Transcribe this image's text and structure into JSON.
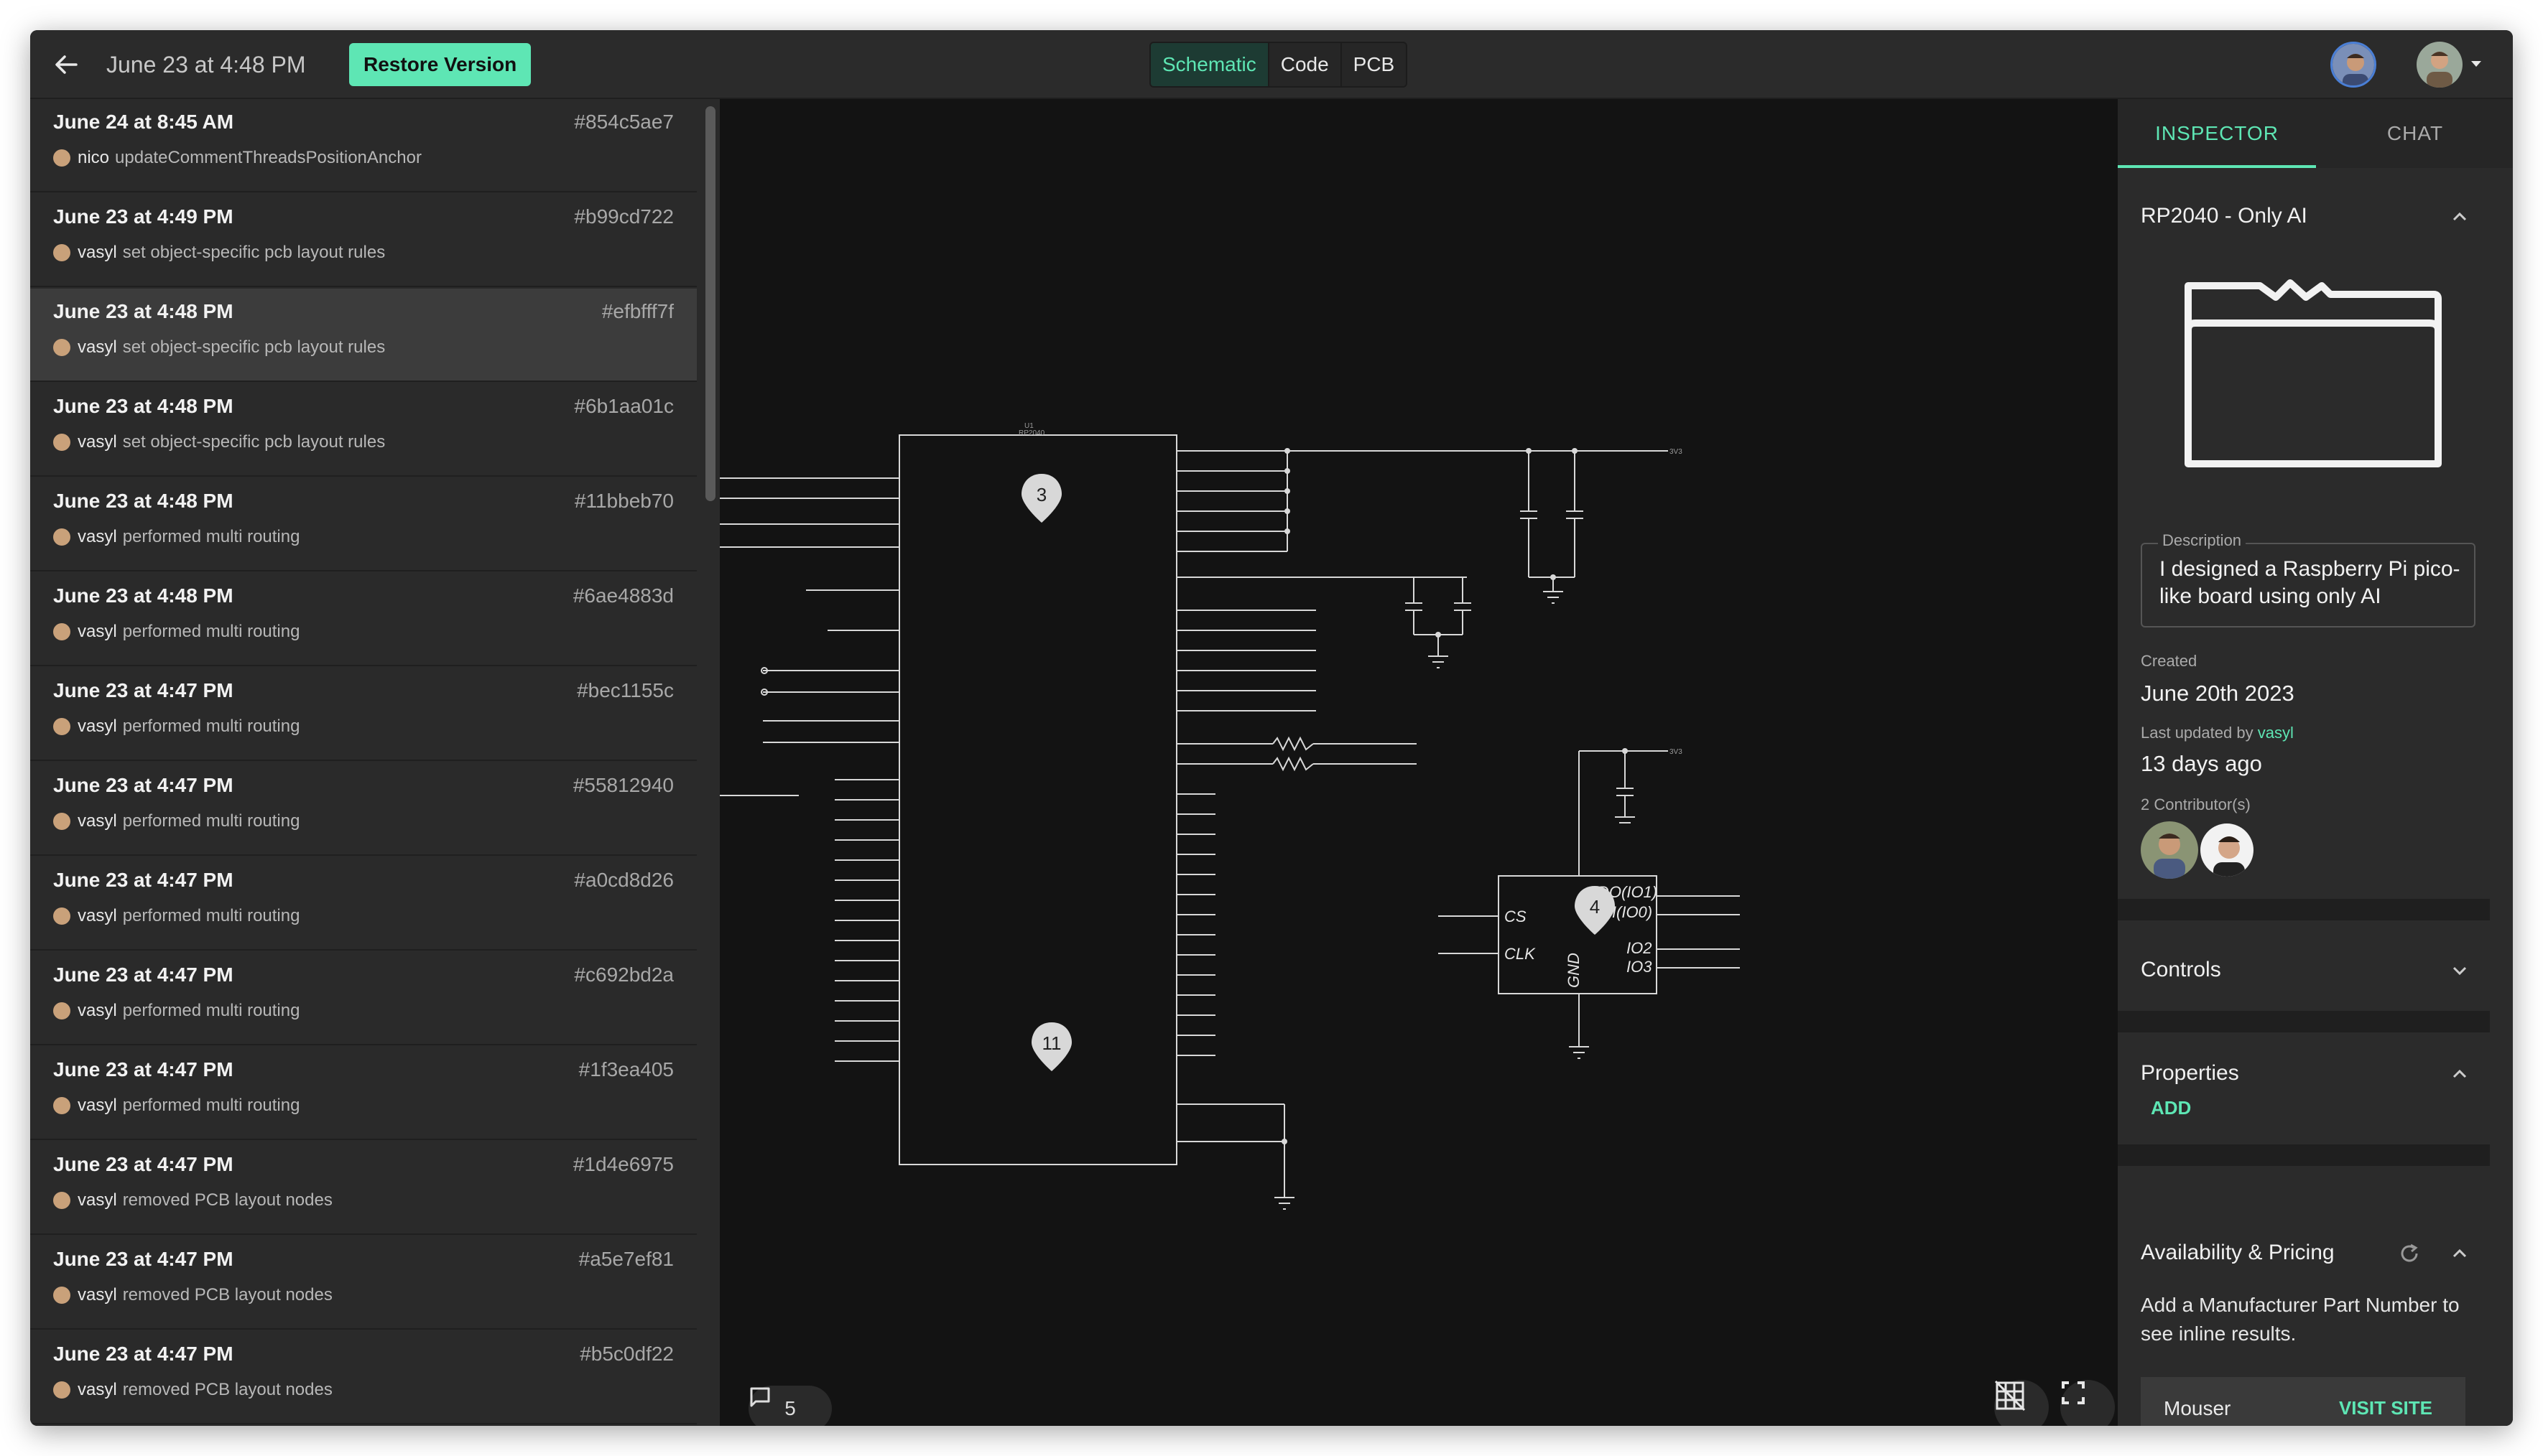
{
  "header": {
    "title": "June 23 at 4:48 PM",
    "restore_label": "Restore Version",
    "tabs": [
      "Schematic",
      "Code",
      "PCB"
    ],
    "active_tab": "Schematic"
  },
  "history": [
    {
      "date": "June 24 at 8:45 AM",
      "hash": "#854c5ae7",
      "user": "nico",
      "action": "updateCommentThreadsPositionAnchor"
    },
    {
      "date": "June 23 at 4:49 PM",
      "hash": "#b99cd722",
      "user": "vasyl",
      "action": "set object-specific pcb layout rules"
    },
    {
      "date": "June 23 at 4:48 PM",
      "hash": "#efbfff7f",
      "user": "vasyl",
      "action": "set object-specific pcb layout rules"
    },
    {
      "date": "June 23 at 4:48 PM",
      "hash": "#6b1aa01c",
      "user": "vasyl",
      "action": "set object-specific pcb layout rules"
    },
    {
      "date": "June 23 at 4:48 PM",
      "hash": "#11bbeb70",
      "user": "vasyl",
      "action": "performed multi routing"
    },
    {
      "date": "June 23 at 4:48 PM",
      "hash": "#6ae4883d",
      "user": "vasyl",
      "action": "performed multi routing"
    },
    {
      "date": "June 23 at 4:47 PM",
      "hash": "#bec1155c",
      "user": "vasyl",
      "action": "performed multi routing"
    },
    {
      "date": "June 23 at 4:47 PM",
      "hash": "#55812940",
      "user": "vasyl",
      "action": "performed multi routing"
    },
    {
      "date": "June 23 at 4:47 PM",
      "hash": "#a0cd8d26",
      "user": "vasyl",
      "action": "performed multi routing"
    },
    {
      "date": "June 23 at 4:47 PM",
      "hash": "#c692bd2a",
      "user": "vasyl",
      "action": "performed multi routing"
    },
    {
      "date": "June 23 at 4:47 PM",
      "hash": "#1f3ea405",
      "user": "vasyl",
      "action": "performed multi routing"
    },
    {
      "date": "June 23 at 4:47 PM",
      "hash": "#1d4e6975",
      "user": "vasyl",
      "action": "removed PCB layout nodes"
    },
    {
      "date": "June 23 at 4:47 PM",
      "hash": "#a5e7ef81",
      "user": "vasyl",
      "action": "removed PCB layout nodes"
    },
    {
      "date": "June 23 at 4:47 PM",
      "hash": "#b5c0df22",
      "user": "vasyl",
      "action": "removed PCB layout nodes"
    }
  ],
  "selected_index": 2,
  "canvas": {
    "comment_count": "5",
    "markers": [
      "3",
      "11",
      "4"
    ],
    "chip_label": "U1",
    "chip_sub": "RP2040",
    "flash_pins_left": [
      "CS",
      "CLK"
    ],
    "flash_pins_right": [
      "DO(IO1)",
      "DI(IO0)",
      "IO2",
      "IO3"
    ],
    "flash_gnd": "GND",
    "net_3v3": "3V3"
  },
  "inspector": {
    "tabs": [
      "INSPECTOR",
      "CHAT"
    ],
    "project_title": "RP2040 - Only AI",
    "description_label": "Description",
    "description": "I designed a Raspberry Pi pico-like board using only AI",
    "created_label": "Created",
    "created": "June 20th 2023",
    "updated_label": "Last updated by",
    "updated_by": "vasyl",
    "updated": "13 days ago",
    "contributors_label": "2 Contributor(s)",
    "controls": "Controls",
    "properties": "Properties",
    "add": "ADD",
    "availability": "Availability & Pricing",
    "availability_text": "Add a Manufacturer Part Number to see inline results.",
    "supplier": "Mouser",
    "visit": "VISIT SITE"
  },
  "colors": {
    "accent": "#5ee6b4",
    "background": "#1a1a1a",
    "panel": "#2b2b2b",
    "canvas": "#131313"
  }
}
